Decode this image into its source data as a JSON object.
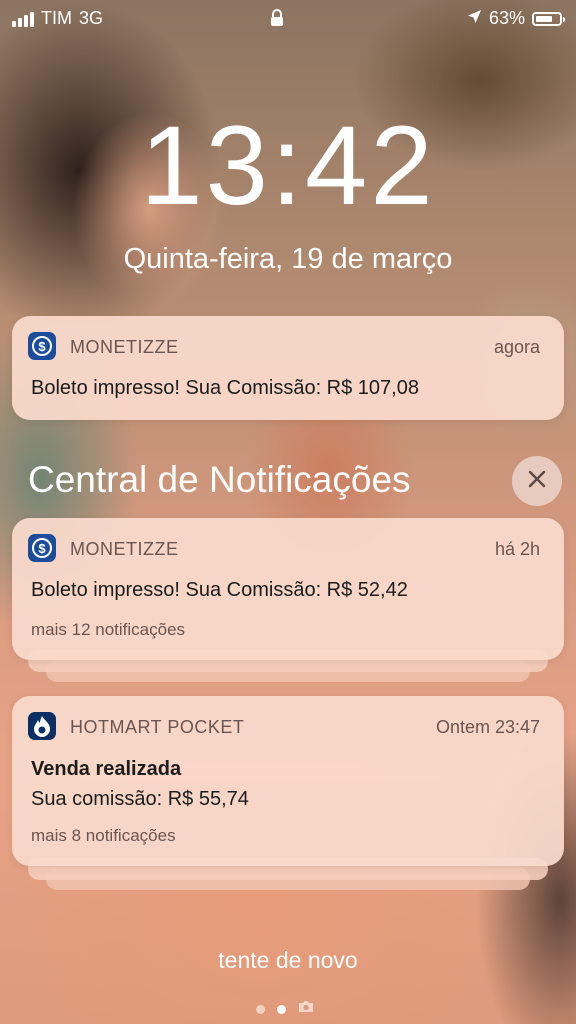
{
  "status_bar": {
    "carrier": "TIM",
    "network": "3G",
    "battery": "63%"
  },
  "lock_screen": {
    "time": "13:42",
    "date": "Quinta-feira, 19 de março"
  },
  "notifications": [
    {
      "app": "MONETIZZE",
      "time": "agora",
      "message": "Boleto impresso! Sua Comissão: R$ 107,08"
    }
  ],
  "notification_center": {
    "title": "Central de Notificações",
    "groups": [
      {
        "app": "MONETIZZE",
        "time": "há 2h",
        "message": "Boleto impresso! Sua Comissão: R$ 52,42",
        "more": "mais 12 notificações"
      },
      {
        "app": "HOTMART POCKET",
        "time": "Ontem 23:47",
        "title": "Venda realizada",
        "message": "Sua comissão: R$ 55,74",
        "more": "mais 8 notificações"
      }
    ]
  },
  "footer": {
    "retry": "tente de novo"
  },
  "icons": {
    "monetizze": "monetizze-app-icon",
    "hotmart": "hotmart-app-icon",
    "close": "close-icon",
    "camera": "camera-icon"
  },
  "colors": {
    "monetizze_icon": "#1c4d9c",
    "hotmart_icon": "#0b2f64",
    "card_bg": "#fadacc"
  }
}
